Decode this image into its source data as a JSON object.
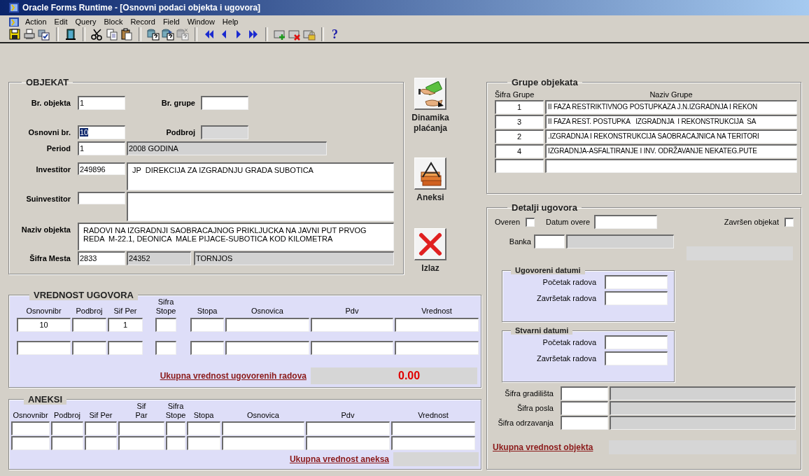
{
  "window": {
    "title": "Oracle Forms Runtime - [Osnovni podaci objekta i ugovora]"
  },
  "menu": [
    "Action",
    "Edit",
    "Query",
    "Block",
    "Record",
    "Field",
    "Window",
    "Help"
  ],
  "toolbar": {
    "help": "?"
  },
  "objekat": {
    "title": "OBJEKAT",
    "br_objekta": {
      "label": "Br. objekta",
      "value": "1"
    },
    "br_grupe": {
      "label": "Br. grupe"
    },
    "osnovni_br": {
      "label": "Osnovni br.",
      "value": "10",
      "highlighted": true
    },
    "podbroj": {
      "label": "Podbroj",
      "disabled": true
    },
    "period": {
      "label": "Period",
      "code": "1",
      "name": "2008 GODINA"
    },
    "investitor": {
      "label": "Investitor",
      "code": "249896",
      "name": "JP  DIREKCIJA ZA IZGRADNJU GRADA SUBOTICA"
    },
    "suinvestitor": {
      "label": "Suinvestitor"
    },
    "naziv_objekta": {
      "label": "Naziv objekta",
      "value": "RADOVI NA IZGRADNJI SAOBRACAJNOG PRIKLJUCKA NA JAVNI PUT PRVOG\nREDA  M-22.1, DEONICA  MALE PIJACE-SUBOTICA KOD KILOMETRA"
    },
    "sifra_mesta": {
      "label": "Šifra Mesta",
      "code": "2833",
      "postal": "24352",
      "name": "TORNJOS"
    }
  },
  "actions": [
    {
      "kind": "payment",
      "label": "Dinamika plaćanja"
    },
    {
      "kind": "annex",
      "label": "Aneksi"
    },
    {
      "kind": "exit",
      "label": "Izlaz"
    }
  ],
  "grupe_objekata": {
    "title": "Grupe objekata",
    "columns": [
      "Šifra Grupe",
      "Naziv Grupe"
    ],
    "rows": [
      {
        "sifra": "1",
        "naziv": "II FAZA RESTRIKTIVNOG POSTUPKAZA J.N.IZGRADNJA I REKON"
      },
      {
        "sifra": "3",
        "naziv": "II FAZA REST. POSTUPKA   IZGRADNJA  I REKONSTRUKCIJA  SA"
      },
      {
        "sifra": "2",
        "naziv": ".IZGRADNJA I REKONSTRUKCIJA SAOBRACAJNICA NA TERITORI"
      },
      {
        "sifra": "4",
        "naziv": "IZGRADNJA-ASFALTIRANJE I INV. ODRŽAVANJE NEKATEG.PUTE"
      }
    ]
  },
  "vrednost_ugovora": {
    "title": "VREDNOST UGOVORA",
    "columns": [
      "Osnovnibr",
      "Podbroj",
      "Sif Per",
      "Sifra Stope",
      "Stopa",
      "Osnovica",
      "Pdv",
      "Vrednost"
    ],
    "rows": [
      {
        "osnovnibr": "10",
        "sif_per": "1"
      },
      {}
    ],
    "total": {
      "label": "Ukupna vrednost ugovorenih radova",
      "value": "0.00"
    }
  },
  "aneksi": {
    "title": "ANEKSI",
    "columns": [
      "Osnovnibr",
      "Podbroj",
      "Sif Per",
      "Sif Par",
      "Sifra Stope",
      "Stopa",
      "Osnovica",
      "Pdv",
      "Vrednost"
    ],
    "rows": [
      {},
      {}
    ],
    "total": {
      "label": "Ukupna vrednost aneksa"
    }
  },
  "detalji_ugovora": {
    "title": "Detalji ugovora",
    "overen": {
      "label": "Overen",
      "checked": false
    },
    "datum_overe": {
      "label": "Datum overe"
    },
    "zavrsen_objekat": {
      "label": "Završen objekat",
      "checked": false
    },
    "banka": {
      "label": "Banka"
    },
    "ugovoreni_datumi": {
      "title": "Ugovoreni datumi",
      "fields": [
        {
          "label": "Početak radova"
        },
        {
          "label": "Završetak radova"
        }
      ]
    },
    "stvarni_datumi": {
      "title": "Stvarni datumi",
      "fields": [
        {
          "label": "Početak radova"
        },
        {
          "label": "Završetak radova"
        }
      ]
    },
    "sifre": [
      {
        "label": "Šifra gradilišta"
      },
      {
        "label": "Šifra posla"
      },
      {
        "label": "Šifra odrzavanja"
      }
    ],
    "total": {
      "label": "Ukupna vrednost objekta"
    }
  }
}
